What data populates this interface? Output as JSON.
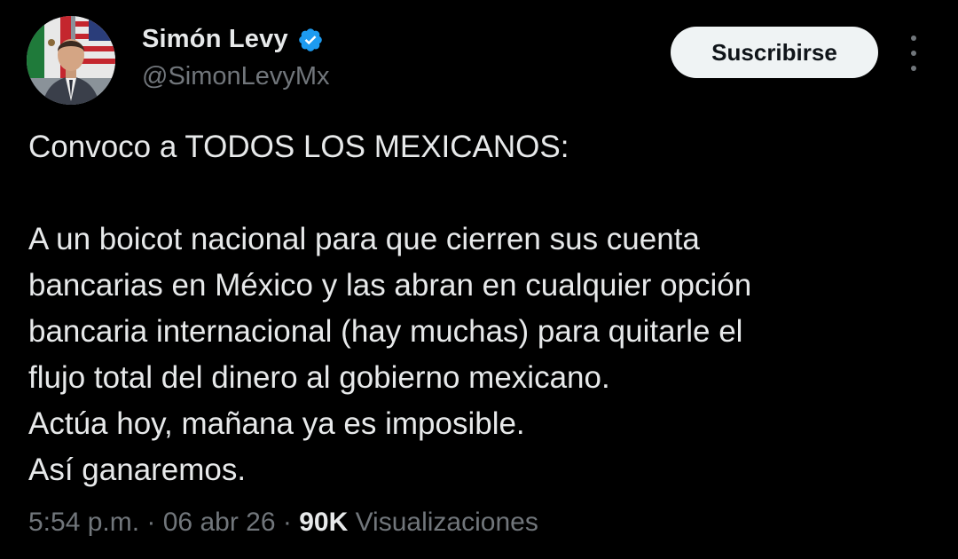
{
  "author": {
    "display_name": "Simón Levy",
    "handle": "@SimonLevyMx",
    "verified_icon": "verified-badge-icon",
    "verified_color": "#1d9bf0"
  },
  "actions": {
    "subscribe_label": "Suscribirse",
    "more_icon": "more-options-icon"
  },
  "tweet": {
    "lines": [
      "Convoco a TODOS LOS MEXICANOS:",
      "",
      "A un boicot nacional para que cierren sus cuenta",
      "bancarias en México y las abran en cualquier opción",
      "bancaria internacional (hay muchas) para quitarle el",
      "flujo total del dinero al gobierno mexicano.",
      "Actúa hoy, mañana ya es imposible.",
      "Así ganaremos."
    ]
  },
  "meta": {
    "time": "5:54 p.m.",
    "separator": " · ",
    "date": "06 abr 26",
    "views_count": "90K",
    "views_label": "Visualizaciones"
  },
  "colors": {
    "background": "#000000",
    "text": "#e7e9ea",
    "secondary": "#71767b",
    "button_bg": "#eff3f4"
  }
}
